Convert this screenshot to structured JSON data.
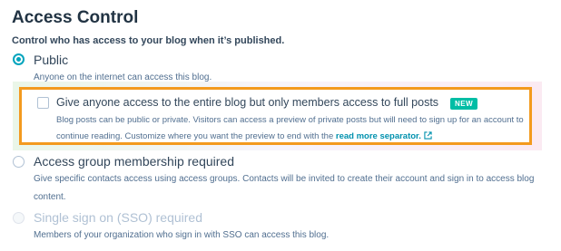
{
  "section": {
    "title": "Access Control",
    "subtitle": "Control who has access to your blog when it’s published."
  },
  "options": {
    "public": {
      "label": "Public",
      "description": "Anyone on the internet can access this blog."
    },
    "members_preview": {
      "label": "Give anyone access to the entire blog but only members access to full posts",
      "badge": "NEW",
      "description": "Blog posts can be public or private. Visitors can access a preview of private posts but will need to sign up for an account to continue reading. Customize where you want the preview to end with the",
      "link_text": "read more separator."
    },
    "access_group": {
      "label": "Access group membership required",
      "description": "Give specific contacts access using access groups. Contacts will be invited to create their account and sign in to access blog content."
    },
    "sso": {
      "label": "Single sign on (SSO) required",
      "description": "Members of your organization who sign in with SSO can access this blog."
    }
  },
  "selected_option": "Public",
  "colors": {
    "accent": "#00a4bd",
    "badge": "#00bda5",
    "highlight_border": "#f39a1e",
    "link": "#0091ae"
  }
}
